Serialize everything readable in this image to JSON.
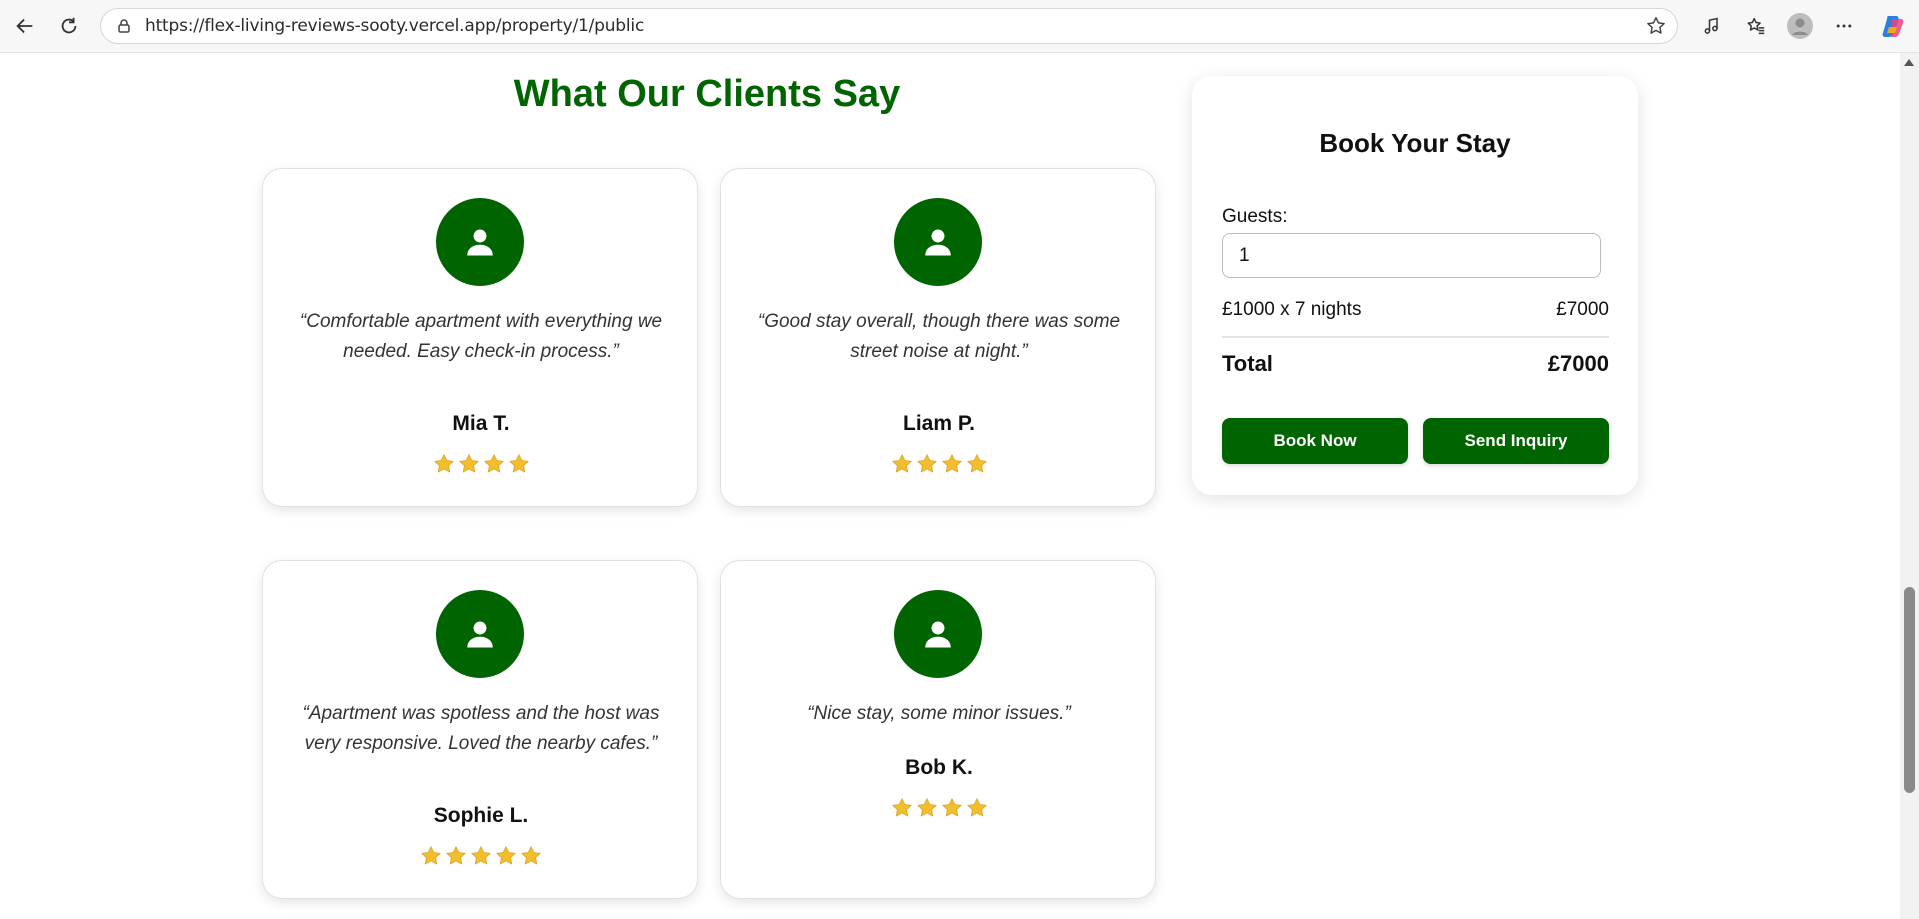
{
  "browser": {
    "url": "https://flex-living-reviews-sooty.vercel.app/property/1/public"
  },
  "reviews_section": {
    "heading": "What Our Clients Say",
    "reviews": [
      {
        "quote": "“Comfortable apartment with everything we needed. Easy check-in process.”",
        "name": "Mia T.",
        "stars": 4
      },
      {
        "quote": "“Good stay overall, though there was some street noise at night.”",
        "name": "Liam P.",
        "stars": 4
      },
      {
        "quote": "“Apartment was spotless and the host was very responsive. Loved the nearby cafes.”",
        "name": "Sophie L.",
        "stars": 5
      },
      {
        "quote": "“Nice stay, some minor issues.”",
        "name": "Bob K.",
        "stars": 4
      }
    ]
  },
  "booking": {
    "title": "Book Your Stay",
    "guests_label": "Guests:",
    "guests_value": "1",
    "rate_label": "£1000 x 7 nights",
    "rate_amount": "£7000",
    "total_label": "Total",
    "total_amount": "£7000",
    "book_now_label": "Book Now",
    "inquiry_label": "Send Inquiry"
  },
  "colors": {
    "brand_green": "#006400",
    "star_gold": "#F2BE2E"
  }
}
